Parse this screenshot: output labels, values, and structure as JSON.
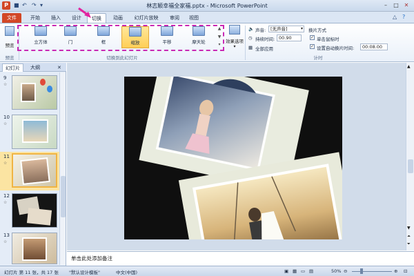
{
  "window": {
    "title": "林志颖幸福全家福.pptx - Microsoft PowerPoint"
  },
  "tabs": [
    {
      "label": "文件"
    },
    {
      "label": "开始"
    },
    {
      "label": "插入"
    },
    {
      "label": "设计"
    },
    {
      "label": "切换"
    },
    {
      "label": "动画"
    },
    {
      "label": "幻灯片放映"
    },
    {
      "label": "审阅"
    },
    {
      "label": "视图"
    }
  ],
  "ribbon": {
    "preview_label": "预览",
    "preview_group": "预览",
    "transitions": [
      {
        "label": "立方体"
      },
      {
        "label": "门"
      },
      {
        "label": "框"
      },
      {
        "label": "缩放"
      },
      {
        "label": "平移"
      },
      {
        "label": "摩天轮"
      }
    ],
    "transition_group": "切换到此幻灯片",
    "effect_options": "效果选项",
    "sound_label": "声音:",
    "sound_value": "[无声音]",
    "duration_label": "持续时间:",
    "duration_value": "00.90",
    "apply_all": "全部应用",
    "advance_heading": "换片方式",
    "on_click_label": "单击鼠标时",
    "after_label": "设置自动换片时间:",
    "after_value": "00:08.00",
    "timing_group": "计时"
  },
  "leftpane": {
    "tab_slides": "幻灯片",
    "tab_outline": "大纲",
    "close_icon": "close-icon",
    "thumbs": [
      {
        "num": "9"
      },
      {
        "num": "10"
      },
      {
        "num": "11"
      },
      {
        "num": "12"
      },
      {
        "num": "13"
      }
    ],
    "star": "☆"
  },
  "notes_placeholder": "单击此处添加备注",
  "status": {
    "slide_info": "幻灯片 第 11 张，共 17 张",
    "theme": "\"默认设计模板\"",
    "language": "中文(中国)",
    "zoom": "50%"
  },
  "colors": {
    "file_tab": "#d24726",
    "highlight_box": "#c928b4",
    "selected_transition": "#ffcf56"
  }
}
